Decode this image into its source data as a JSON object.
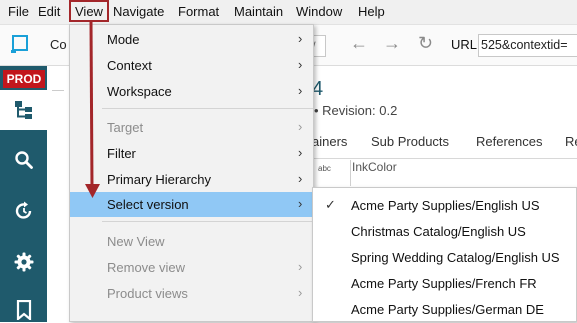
{
  "menubar": {
    "items": [
      "File",
      "Edit",
      "View",
      "Navigate",
      "Format",
      "Maintain",
      "Window",
      "Help"
    ],
    "highlight_color": "#a3262a"
  },
  "toolbar": {
    "title_fragment": "Co",
    "url_label": "URL",
    "url_value": "525&contextid="
  },
  "sidebar": {
    "badge": "PROD",
    "badge_color": "#c2161c",
    "background": "#1f5a6c",
    "icons": [
      "tree-icon",
      "search-icon",
      "history-icon",
      "gear-icon",
      "bookmark-icon"
    ]
  },
  "content": {
    "title_fragment": "4",
    "revision": "• Revision: 0.2",
    "tabs": [
      "ainers",
      "Sub Products",
      "References",
      "Re"
    ],
    "row_label": "InkColor"
  },
  "view_menu": {
    "items": [
      {
        "label": "Mode",
        "submenu": true,
        "disabled": false
      },
      {
        "label": "Context",
        "submenu": true,
        "disabled": false
      },
      {
        "label": "Workspace",
        "submenu": true,
        "disabled": false
      },
      {
        "label": "Target",
        "submenu": true,
        "disabled": true
      },
      {
        "label": "Filter",
        "submenu": true,
        "disabled": false
      },
      {
        "label": "Primary Hierarchy",
        "submenu": true,
        "disabled": false
      },
      {
        "label": "Select version",
        "submenu": true,
        "disabled": false,
        "active": true
      },
      {
        "label": "New View",
        "submenu": false,
        "disabled": true
      },
      {
        "label": "Remove view",
        "submenu": true,
        "disabled": true
      },
      {
        "label": "Product views",
        "submenu": true,
        "disabled": true
      }
    ],
    "active_color": "#90c8f5"
  },
  "version_submenu": {
    "items": [
      {
        "label": "Acme Party Supplies/English US",
        "checked": true
      },
      {
        "label": "Christmas Catalog/English US",
        "checked": false
      },
      {
        "label": "Spring Wedding Catalog/English US",
        "checked": false
      },
      {
        "label": "Acme Party Supplies/French FR",
        "checked": false
      },
      {
        "label": "Acme Party Supplies/German DE",
        "checked": false
      }
    ]
  },
  "glyphs": {
    "submenu_arrow": "›",
    "check": "✓",
    "back": "←",
    "forward": "→",
    "reload": "↻",
    "combo": "∨"
  }
}
